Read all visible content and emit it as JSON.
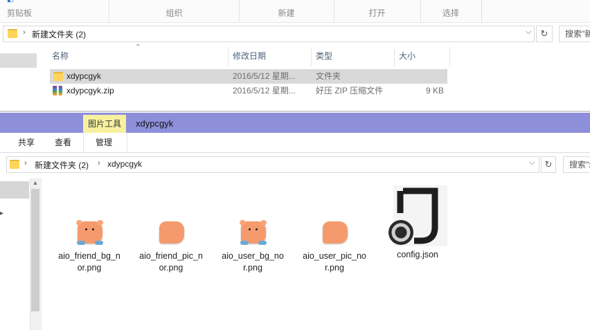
{
  "back_window": {
    "ribbon_groups": [
      "剪贴板",
      "组织",
      "新建",
      "打开",
      "选择"
    ],
    "breadcrumb": [
      "新建文件夹 (2)"
    ],
    "search_placeholder": "搜索\"新",
    "columns": [
      "名称",
      "修改日期",
      "类型",
      "大小"
    ],
    "rows": [
      {
        "name": "xdypcgyk",
        "date": "2016/5/12 星期...",
        "type": "文件夹",
        "size": ""
      },
      {
        "name": "xdypcgyk.zip",
        "date": "2016/5/12 星期...",
        "type": "好压 ZIP 压缩文件",
        "size": "9 KB"
      }
    ]
  },
  "front_window": {
    "contextual_tab_group": "图片工具",
    "title": "xdypcgyk",
    "tabs": [
      "共享",
      "查看",
      "管理"
    ],
    "breadcrumb": [
      "新建文件夹 (2)",
      "xdypcgyk"
    ],
    "search_placeholder": "搜索\"x",
    "files": [
      {
        "name": "aio_friend_bg_nor.png",
        "label_lines": [
          "aio_friend_bg_n",
          "or.png"
        ],
        "icon": "pig-bubble-icon"
      },
      {
        "name": "aio_friend_pic_nor.png",
        "label_lines": [
          "aio_friend_pic_n",
          "or.png"
        ],
        "icon": "orange-bubble-icon"
      },
      {
        "name": "aio_user_bg_nor.png",
        "label_lines": [
          "aio_user_bg_no",
          "r.png"
        ],
        "icon": "pig-bubble-icon"
      },
      {
        "name": "aio_user_pic_nor.png",
        "label_lines": [
          "aio_user_pic_no",
          "r.png"
        ],
        "icon": "orange-bubble-icon"
      },
      {
        "name": "config.json",
        "label_lines": [
          "config.json"
        ],
        "icon": "json-file-icon"
      }
    ]
  },
  "colors": {
    "title_bar": "#8e8fda",
    "contextual_tab": "#f7f19f",
    "selection": "#d9d9d9",
    "folder": "#ffd45a",
    "bubble": "#f59a6c"
  }
}
